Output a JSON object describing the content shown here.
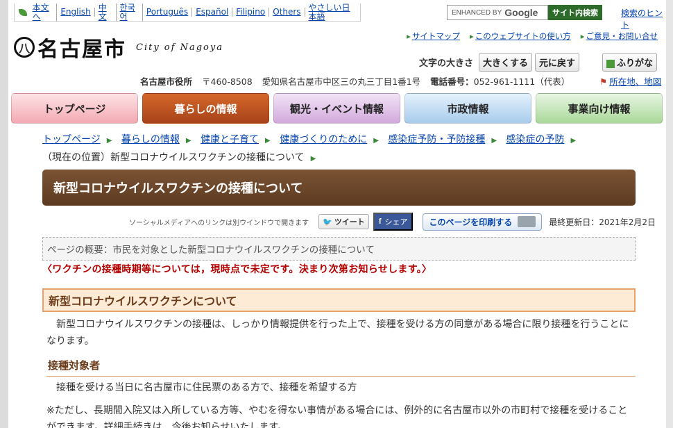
{
  "language_bar": {
    "items": [
      "本文へ",
      "English",
      "中文",
      "한국어",
      "Português",
      "Español",
      "Filipino",
      "Others",
      "やさしい日本語"
    ]
  },
  "search": {
    "placeholder": "ENHANCED BY",
    "google": "Google",
    "button_label": "サイト内検索",
    "hint_link": "検索のヒント"
  },
  "logo": {
    "mark": "八",
    "name": "名古屋市",
    "english": "City of Nagoya"
  },
  "util_links": [
    "サイトマップ",
    "このウェブサイトの使い方",
    "ご意見・お問い合せ"
  ],
  "text_size": {
    "label": "文字の大きさ",
    "larger": "大きくする",
    "reset": "元に戻す",
    "furigana": "ふりがな"
  },
  "address": {
    "office": "名古屋市役所",
    "postal": "〒460-8508",
    "addr": "愛知県名古屋市中区三の丸三丁目1番1号",
    "phone_label": "電話番号：",
    "phone": "052-961-1111（代表）",
    "map_link": "所在地、地図"
  },
  "nav": [
    "トップページ",
    "暮らしの情報",
    "観光・イベント情報",
    "市政情報",
    "事業向け情報"
  ],
  "breadcrumb": {
    "items": [
      "トップページ",
      "暮らしの情報",
      "健康と子育て",
      "健康づくりのために",
      "感染症予防・予防接種",
      "感染症の予防"
    ],
    "current": "（現在の位置）新型コロナウイルスワクチンの接種について"
  },
  "page_title": "新型コロナウイルスワクチンの接種について",
  "social": {
    "note": "ソーシャルメディアへのリンクは別ウインドウで開きます",
    "tweet": "ツイート",
    "share": "シェア",
    "print": "このページを印刷する",
    "updated": "最終更新日：2021年2月2日"
  },
  "summary": "ページの概要：市民を対象とした新型コロナウイルスワクチンの接種について",
  "notice": "〈ワクチンの接種時期等については，現時点で未定です。決まり次第お知らせします。〉",
  "section": {
    "heading": "新型コロナウイルスワクチンについて",
    "body": "　新型コロナウイルスワクチンの接種は、しっかり情報提供を行った上で、接種を受ける方の同意がある場合に限り接種を行うことになります。",
    "sub_heading": "接種対象者",
    "sub_body": "　接種を受ける当日に名古屋市に住民票のある方で、接種を希望する方",
    "note": "※ただし、長期間入院又は入所している方等、やむを得ない事情がある場合には、例外的に名古屋市以外の市町村で接種を受けることができます。詳細手続きは、今後お知らせいたします。"
  },
  "colors": {
    "title_bar": "#6b4529",
    "active_tab": "#c0561f",
    "notice": "#b20000",
    "heading_bg": "#fdebd6"
  }
}
